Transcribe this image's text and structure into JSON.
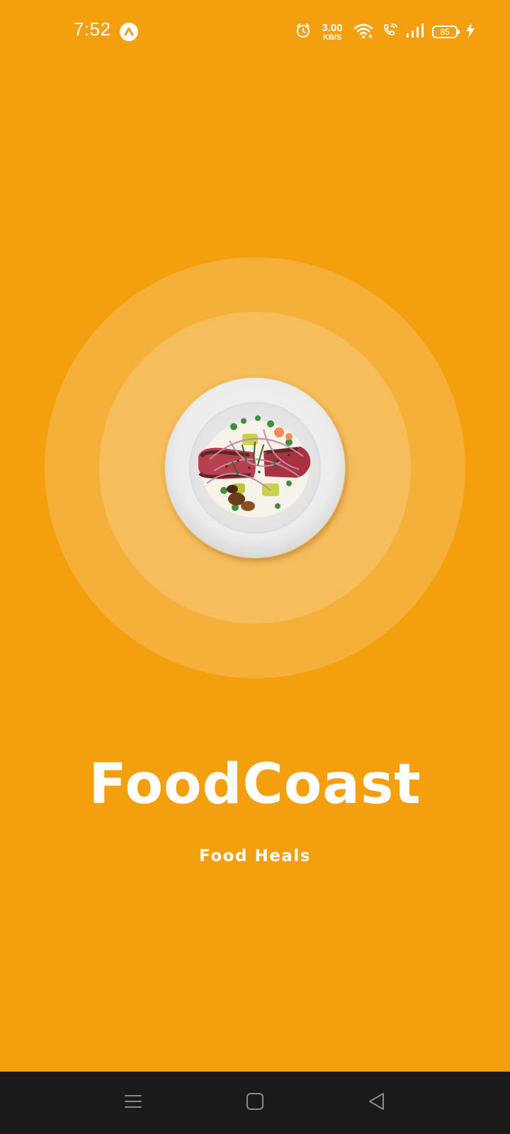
{
  "status_bar": {
    "time": "7:52",
    "net_speed_value": "3.00",
    "net_speed_unit": "KB/S",
    "battery_level": "85",
    "icons": [
      "app-notification-icon",
      "alarm-icon",
      "wifi-icon",
      "wifi-calling-icon",
      "signal-icon",
      "battery-icon",
      "charging-icon"
    ]
  },
  "splash": {
    "title": "FoodCoast",
    "tagline": "Food Heals",
    "hero_image": "food-plate-image"
  },
  "nav_bar": {
    "icons": [
      "recents-icon",
      "home-icon",
      "back-icon"
    ]
  },
  "colors": {
    "background": "#F39F0E",
    "ring_outer": "#F5B039",
    "ring_inner": "#F6BD5C",
    "text": "#FFFFFF",
    "nav_bar": "#1A1A1A"
  }
}
